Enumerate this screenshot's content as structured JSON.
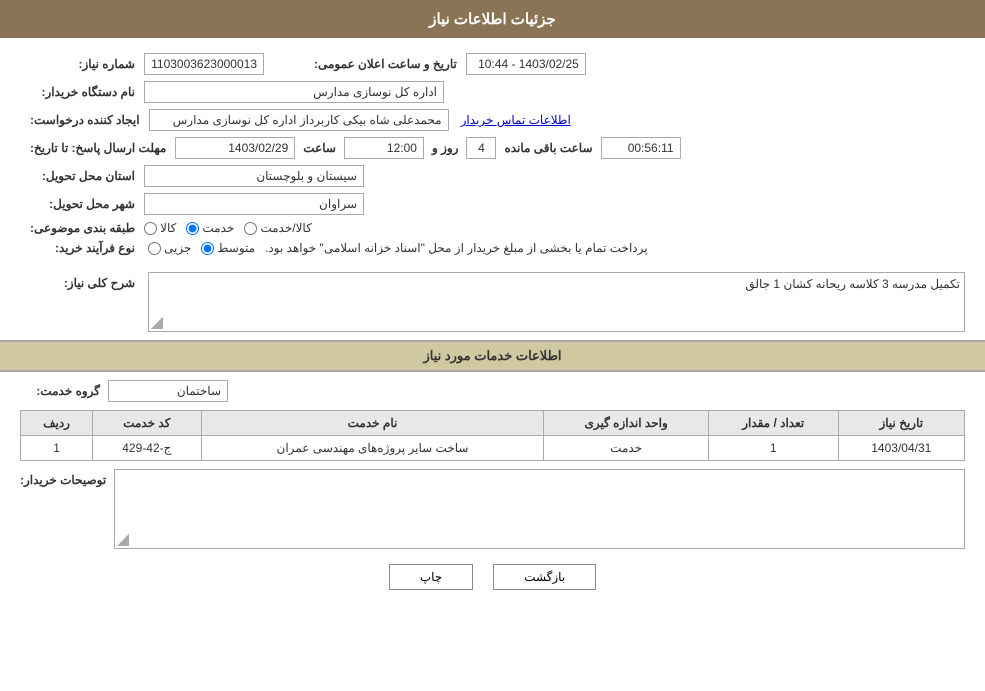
{
  "header": {
    "title": "جزئیات اطلاعات نیاز"
  },
  "fields": {
    "need_number_label": "شماره نیاز:",
    "need_number_value": "1103003623000013",
    "announce_date_label": "تاریخ و ساعت اعلان عمومی:",
    "announce_date_value": "1403/02/25 - 10:44",
    "buyer_name_label": "نام دستگاه خریدار:",
    "buyer_name_value": "اداره کل نوسازی مدارس",
    "creator_label": "ایجاد کننده درخواست:",
    "creator_value": "محمدعلی شاه بیکی کاربرداز اداره کل نوسازی مدارس",
    "creator_link": "اطلاعات تماس خریدار",
    "deadline_label": "مهلت ارسال پاسخ: تا تاریخ:",
    "deadline_date": "1403/02/29",
    "deadline_time_label": "ساعت",
    "deadline_time": "12:00",
    "deadline_days_label": "روز و",
    "deadline_days": "4",
    "deadline_remaining_label": "ساعت باقی مانده",
    "deadline_remaining": "00:56:11",
    "province_label": "استان محل تحویل:",
    "province_value": "سیستان و بلوچستان",
    "city_label": "شهر محل تحویل:",
    "city_value": "سراوان",
    "category_label": "طبقه بندی موضوعی:",
    "category_options": [
      "کالا",
      "خدمت",
      "کالا/خدمت"
    ],
    "category_selected": "خدمت",
    "process_label": "نوع فرآیند خرید:",
    "process_options": [
      "جزیی",
      "متوسط"
    ],
    "process_selected": "متوسط",
    "process_note": "پرداخت تمام یا بخشی از مبلغ خریدار از محل \"اسناد خزانه اسلامی\" خواهد بود.",
    "description_label": "شرح کلی نیاز:",
    "description_value": "تکمیل مدرسه 3 کلاسه ریحانه کشان 1 جالق",
    "services_section_label": "اطلاعات خدمات مورد نیاز",
    "service_group_label": "گروه خدمت:",
    "service_group_value": "ساختمان",
    "table_headers": {
      "row_number": "ردیف",
      "service_code": "کد خدمت",
      "service_name": "نام خدمت",
      "unit": "واحد اندازه گیری",
      "quantity": "تعداد / مقدار",
      "need_date": "تاریخ نیاز"
    },
    "table_rows": [
      {
        "row_number": "1",
        "service_code": "ج-42-429",
        "service_name": "ساخت سایر پروژه‌های مهندسی عمران",
        "unit": "خدمت",
        "quantity": "1",
        "need_date": "1403/04/31"
      }
    ],
    "buyer_notes_label": "توصیحات خریدار:",
    "buyer_notes_value": ""
  },
  "buttons": {
    "print": "چاپ",
    "back": "بازگشت"
  }
}
